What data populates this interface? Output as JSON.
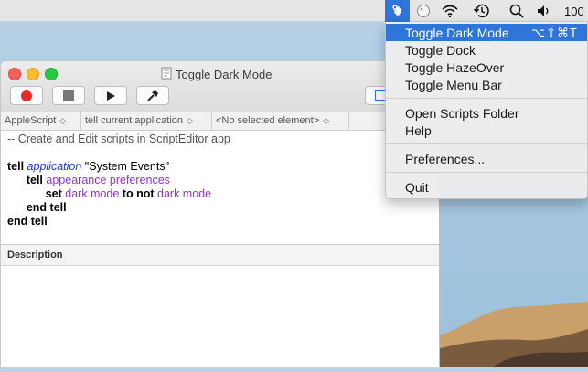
{
  "menubar": {
    "icons": [
      "script-menu-icon",
      "circle-status-icon",
      "wifi-icon",
      "time-machine-icon",
      "spotlight-search-icon",
      "volume-icon"
    ],
    "battery_text": "100"
  },
  "window": {
    "title": "Toggle Dark Mode",
    "toolbar": [
      "record-button",
      "stop-button",
      "run-button",
      "compile-button"
    ],
    "navbar": {
      "language": "AppleScript",
      "target": "tell current application",
      "element": "<No selected element>"
    },
    "code": {
      "comment": "-- Create and Edit scripts in ScriptEditor app",
      "l2_kw": "tell",
      "l2_cls": "application",
      "l2_str": "\"System Events\"",
      "l3_kw": "tell",
      "l3_prop": "appearance preferences",
      "l4_set": "set",
      "l4_prop": "dark mode",
      "l4_to": "to",
      "l4_not": "not",
      "l4_prop2": "dark mode",
      "l5": "end tell",
      "l6": "end tell"
    },
    "description_label": "Description"
  },
  "dropdown": {
    "items": [
      {
        "label": "Toggle Dark Mode",
        "shortcut": "⌥⇧⌘T"
      },
      {
        "label": "Toggle Dock"
      },
      {
        "label": "Toggle HazeOver"
      },
      {
        "label": "Toggle Menu Bar"
      },
      {
        "label": "Open Scripts Folder"
      },
      {
        "label": "Help"
      },
      {
        "label": "Preferences..."
      },
      {
        "label": "Quit"
      }
    ]
  },
  "colors": {
    "highlight": "#2f74d9",
    "close": "#fc5f57",
    "minimize": "#fdbc2e",
    "zoom": "#28c840"
  }
}
